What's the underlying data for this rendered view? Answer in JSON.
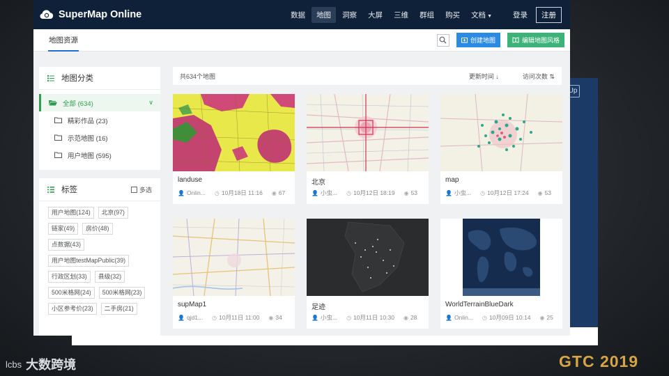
{
  "app": {
    "title": "SuperMap Online"
  },
  "nav": {
    "items": [
      {
        "label": "数据",
        "active": false
      },
      {
        "label": "地图",
        "active": true
      },
      {
        "label": "洞察",
        "active": false
      },
      {
        "label": "大屏",
        "active": false
      },
      {
        "label": "三维",
        "active": false
      },
      {
        "label": "群组",
        "active": false
      },
      {
        "label": "购买",
        "active": false
      },
      {
        "label": "文档",
        "active": false
      }
    ],
    "login": "登录",
    "register": "注册"
  },
  "subbar": {
    "tab": "地图资源",
    "create_button": "创建地图",
    "edit_style_button": "编辑地图风格"
  },
  "categories": {
    "title": "地图分类",
    "items": [
      {
        "label": "全部 (634)",
        "active": true
      },
      {
        "label": "精彩作品 (23)",
        "active": false
      },
      {
        "label": "示范地图 (16)",
        "active": false
      },
      {
        "label": "用户地图 (595)",
        "active": false
      }
    ]
  },
  "tags": {
    "title": "标签",
    "multi_select": "多选",
    "items": [
      "用户地图(124)",
      "北京(97)",
      "链家(49)",
      "房价(48)",
      "点数据(43)",
      "用户地图testMapPublic(39)",
      "行政区划(33)",
      "县级(32)",
      "500米格网(24)",
      "500米格网(23)",
      "小区参考价(23)",
      "二手房(21)"
    ]
  },
  "list": {
    "total": "共634个地图",
    "sort_updated": "更新时间",
    "sort_visits": "访问次数"
  },
  "maps": [
    {
      "title": "landuse",
      "owner": "Onlin...",
      "time": "10月18日 11:16",
      "views": "67"
    },
    {
      "title": "北京",
      "owner": "小虫...",
      "time": "10月12日 18:19",
      "views": "53"
    },
    {
      "title": "map",
      "owner": "小虫...",
      "time": "10月12日 17:24",
      "views": "53"
    },
    {
      "title": "supMap1",
      "owner": "qjd1...",
      "time": "10月11日 11:00",
      "views": "34"
    },
    {
      "title": "足迹",
      "owner": "小虫...",
      "time": "10月11日 10:30",
      "views": "28"
    },
    {
      "title": "WorldTerrainBlueDark",
      "owner": "Onlin...",
      "time": "10月09日 10:14",
      "views": "25"
    }
  ],
  "background": {
    "corner_logo": "大数跨境",
    "corner_mark": "lcbs",
    "event": "GTC 2019",
    "side_chip": "Up"
  },
  "colors": {
    "topbar": "#0f2138",
    "primary_blue": "#2b8be3",
    "green": "#3db37a",
    "active_green": "#2e9d53",
    "gtc_gold": "#d7a546"
  }
}
